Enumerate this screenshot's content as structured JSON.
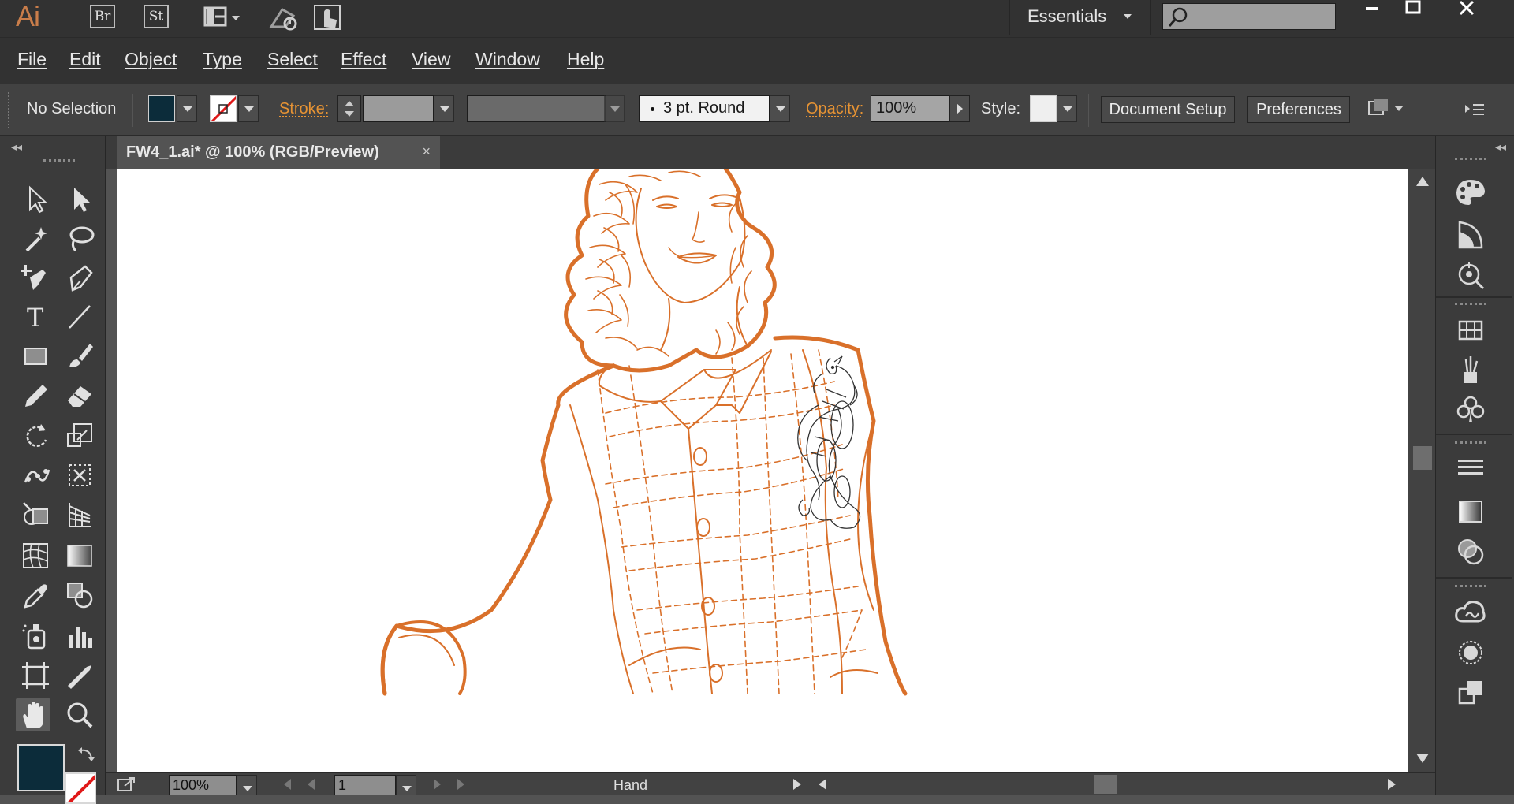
{
  "app": {
    "logo": "Ai",
    "bridge_label": "Br",
    "stock_label": "St",
    "workspace_label": "Essentials",
    "search_placeholder": ""
  },
  "menu": {
    "items": [
      "File",
      "Edit",
      "Object",
      "Type",
      "Select",
      "Effect",
      "View",
      "Window",
      "Help"
    ]
  },
  "control_bar": {
    "selection_label": "No Selection",
    "stroke_label": "Stroke:",
    "stroke_weight_value": "",
    "variable_width_value": "",
    "brush_value": "3 pt. Round",
    "opacity_label": "Opacity:",
    "opacity_value": "100%",
    "style_label": "Style:",
    "document_setup_label": "Document Setup",
    "preferences_label": "Preferences"
  },
  "document": {
    "tab_title": "FW4_1.ai* @ 100% (RGB/Preview)",
    "close_symbol": "×"
  },
  "status_bar": {
    "zoom_value": "100%",
    "artboard_number": "1",
    "current_tool": "Hand"
  },
  "colors": {
    "fill": "#0c2c3a",
    "stroke": "none",
    "accent_orange": "#e69334",
    "artwork_stroke": "#d9702a",
    "panel_bg": "#3b3b3b",
    "canvas_bg": "#535353"
  },
  "tools": {
    "active": "hand-tool",
    "items": [
      "selection-tool",
      "direct-selection-tool",
      "magic-wand-tool",
      "lasso-tool",
      "add-anchor-point-tool",
      "pen-tool",
      "type-tool",
      "line-segment-tool",
      "rectangle-tool",
      "paintbrush-tool",
      "pencil-tool",
      "eraser-tool",
      "rotate-tool",
      "scale-tool",
      "puppet-warp-tool",
      "free-transform-tool",
      "shape-builder-tool",
      "perspective-grid-tool",
      "mesh-tool",
      "gradient-tool",
      "eyedropper-tool",
      "blend-tool",
      "symbol-sprayer-tool",
      "column-graph-tool",
      "artboard-tool",
      "slice-tool",
      "hand-tool",
      "zoom-tool"
    ]
  },
  "dock": {
    "icons": [
      "color-icon",
      "color-guide-icon",
      "color-themes-icon",
      "swatches-icon",
      "brushes-icon",
      "symbols-icon",
      "stroke-icon",
      "gradient-icon",
      "transparency-icon",
      "libraries-icon",
      "appearance-icon",
      "graphic-styles-icon"
    ]
  }
}
